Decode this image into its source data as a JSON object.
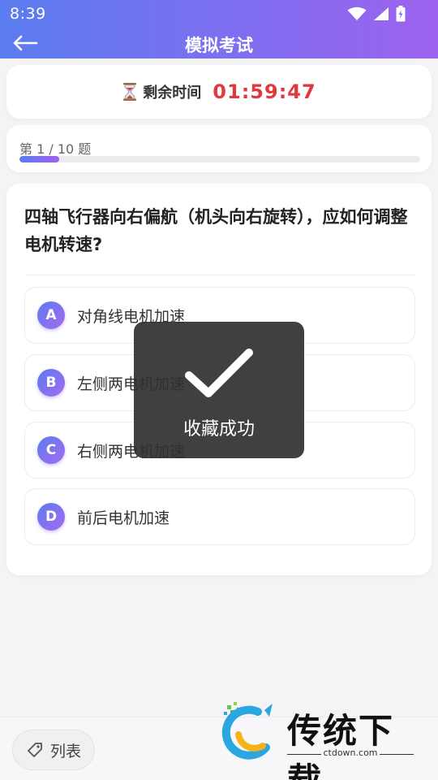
{
  "status_bar": {
    "time": "8:39"
  },
  "header": {
    "title": "模拟考试"
  },
  "timer": {
    "label": "剩余时间",
    "value": "01:59:47"
  },
  "progress": {
    "text": "第 1 / 10 题",
    "current": 1,
    "total": 10,
    "fraction": 0.1
  },
  "question": {
    "text": "四轴飞行器向右偏航（机头向右旋转），应如何调整电机转速?",
    "options": [
      {
        "letter": "A",
        "text": "对角线电机加速"
      },
      {
        "letter": "B",
        "text": "左侧两电机加速"
      },
      {
        "letter": "C",
        "text": "右侧两电机加速"
      },
      {
        "letter": "D",
        "text": "前后电机加速"
      }
    ]
  },
  "toast": {
    "text": "收藏成功",
    "icon": "checkmark-icon"
  },
  "bottom_bar": {
    "list_label": "列表",
    "list_icon": "tag-icon"
  },
  "watermark": {
    "brand": "传统下载",
    "url": "ctdown.com"
  },
  "colors": {
    "accent_start": "#5b7cf0",
    "accent_end": "#9d63ee",
    "timer": "#e0393e"
  }
}
